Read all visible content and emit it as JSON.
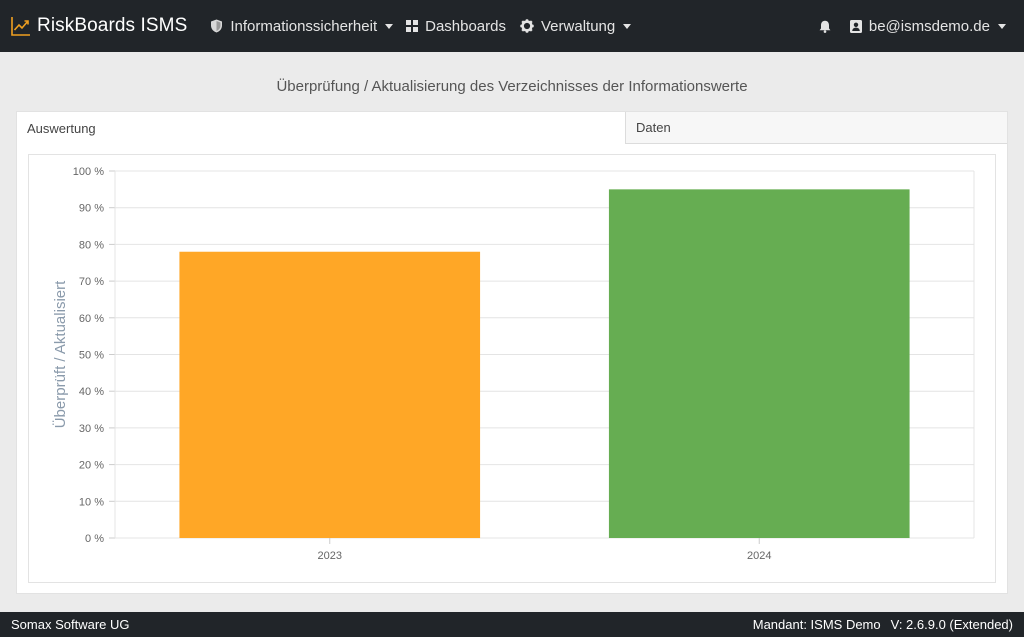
{
  "navbar": {
    "brand": "RiskBoards ISMS",
    "brand_icon": "chart-line-icon",
    "items": [
      {
        "label": "Informationssicherheit",
        "icon": "shield-icon",
        "dropdown": true
      },
      {
        "label": "Dashboards",
        "icon": "grid-icon",
        "dropdown": false
      },
      {
        "label": "Verwaltung",
        "icon": "gear-icon",
        "dropdown": true
      }
    ],
    "notifications_icon": "bell-icon",
    "user": {
      "label": "be@ismsdemo.de",
      "icon": "user-card-icon",
      "dropdown": true
    }
  },
  "page": {
    "title": "Überprüfung / Aktualisierung des Verzeichnisses der Informationswerte"
  },
  "tabs": [
    {
      "label": "Auswertung",
      "active": true
    },
    {
      "label": "Daten",
      "active": false
    }
  ],
  "chart_data": {
    "type": "bar",
    "categories": [
      "2023",
      "2024"
    ],
    "values": [
      78,
      95
    ],
    "colors": [
      "#ffa726",
      "#66ad52"
    ],
    "title": "",
    "xlabel": "",
    "ylabel": "Überprüft / Aktualisiert",
    "ylim": [
      0,
      100
    ],
    "ytick_step": 10,
    "ytick_suffix": " %",
    "grid": true,
    "legend": "none"
  },
  "footer": {
    "company": "Somax Software UG",
    "mandant": "Mandant: ISMS Demo",
    "version": "V: 2.6.9.0 (Extended)"
  },
  "colors": {
    "navbar_bg": "#212529",
    "brand_accent": "#f0a020",
    "page_bg": "#ebebeb"
  }
}
